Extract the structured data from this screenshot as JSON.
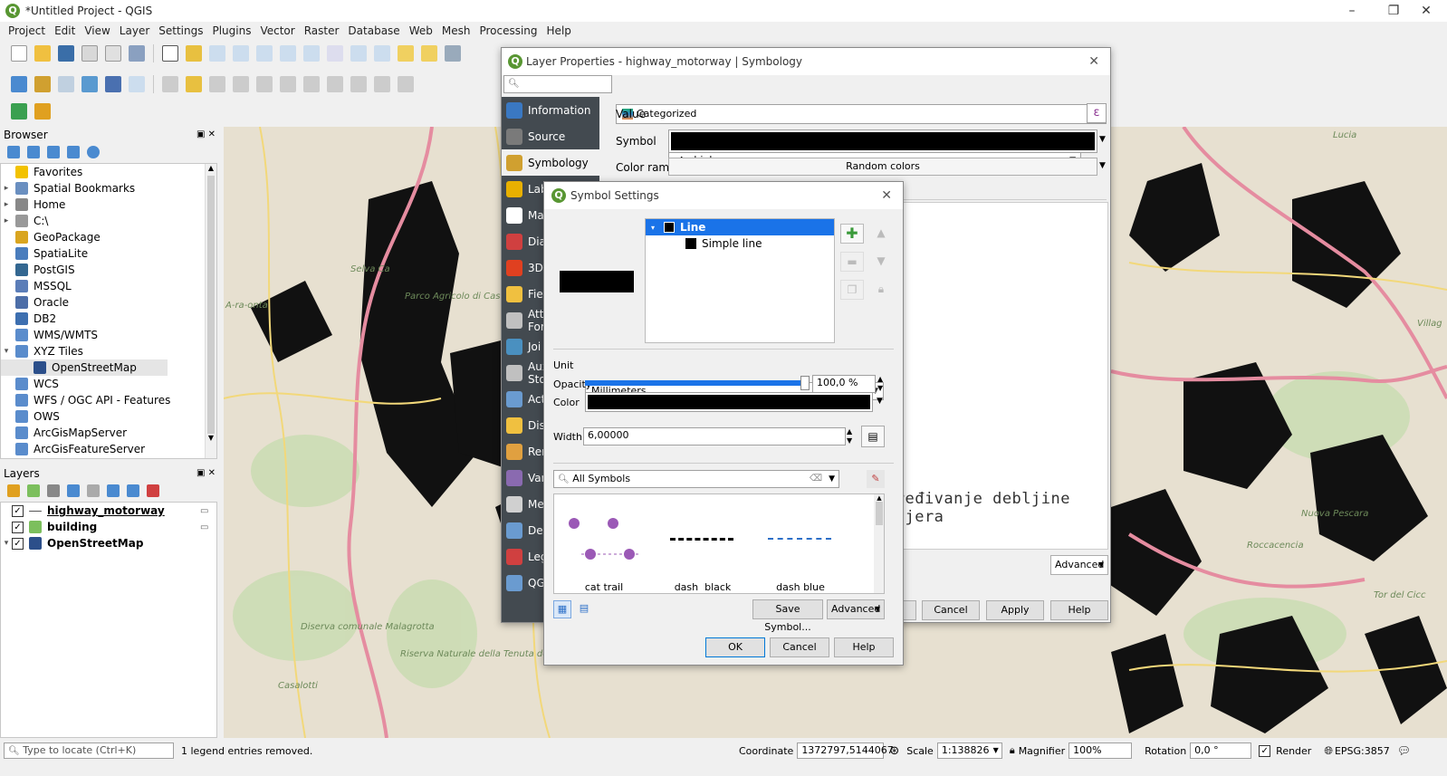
{
  "window": {
    "title": "*Untitled Project - QGIS"
  },
  "menu": [
    "Project",
    "Edit",
    "View",
    "Layer",
    "Settings",
    "Plugins",
    "Vector",
    "Raster",
    "Database",
    "Web",
    "Mesh",
    "Processing",
    "Help"
  ],
  "browser": {
    "title": "Browser",
    "items": [
      {
        "label": "Favorites",
        "icon": "star-icon",
        "color": "#f2c200",
        "arrow": ""
      },
      {
        "label": "Spatial Bookmarks",
        "icon": "bookmark-icon",
        "color": "#6a8fc0",
        "arrow": "▸"
      },
      {
        "label": "Home",
        "icon": "home-icon",
        "color": "#888",
        "arrow": "▸"
      },
      {
        "label": "C:\\",
        "icon": "drive-icon",
        "color": "#999",
        "arrow": "▸"
      },
      {
        "label": "GeoPackage",
        "icon": "geopackage-icon",
        "color": "#d9a520",
        "arrow": ""
      },
      {
        "label": "SpatiaLite",
        "icon": "spatialite-icon",
        "color": "#4a7dbd",
        "arrow": ""
      },
      {
        "label": "PostGIS",
        "icon": "postgis-icon",
        "color": "#336791",
        "arrow": ""
      },
      {
        "label": "MSSQL",
        "icon": "mssql-icon",
        "color": "#5b7db8",
        "arrow": ""
      },
      {
        "label": "Oracle",
        "icon": "oracle-icon",
        "color": "#4d6ea8",
        "arrow": ""
      },
      {
        "label": "DB2",
        "icon": "db2-icon",
        "color": "#3d6fb0",
        "arrow": ""
      },
      {
        "label": "WMS/WMTS",
        "icon": "globe-icon",
        "color": "#5a8ccc",
        "arrow": ""
      },
      {
        "label": "XYZ Tiles",
        "icon": "globe-icon",
        "color": "#5a8ccc",
        "arrow": "▾"
      },
      {
        "label": "OpenStreetMap",
        "icon": "grid-icon",
        "color": "#2c4f8a",
        "arrow": "",
        "indent": true,
        "selected": true
      },
      {
        "label": "WCS",
        "icon": "globe-icon",
        "color": "#5a8ccc",
        "arrow": ""
      },
      {
        "label": "WFS / OGC API - Features",
        "icon": "globe-icon",
        "color": "#5a8ccc",
        "arrow": ""
      },
      {
        "label": "OWS",
        "icon": "globe-icon",
        "color": "#5a8ccc",
        "arrow": ""
      },
      {
        "label": "ArcGisMapServer",
        "icon": "globe-icon",
        "color": "#5a8ccc",
        "arrow": ""
      },
      {
        "label": "ArcGisFeatureServer",
        "icon": "globe-icon",
        "color": "#5a8ccc",
        "arrow": ""
      }
    ]
  },
  "layers": {
    "title": "Layers",
    "items": [
      {
        "label": "highway_motorway",
        "underline": true,
        "icon": "line-icon",
        "color": "#555"
      },
      {
        "label": "building",
        "underline": false,
        "icon": "polygon-icon",
        "color": "#7cbf5d"
      },
      {
        "label": "OpenStreetMap",
        "underline": false,
        "icon": "grid-icon",
        "color": "#2c4f8a",
        "arrow": "▾"
      }
    ]
  },
  "layer_props": {
    "title": "Layer Properties - highway_motorway | Symbology",
    "renderer": "Categorized",
    "value_label": "Value",
    "value": "highway",
    "value_prefix": "abc",
    "symbol_label": "Symbol",
    "color_ramp_label": "Color ramp",
    "color_ramp": "Random colors",
    "tabs": [
      {
        "label": "Information",
        "color": "#3a78c2",
        "icon": "info-icon"
      },
      {
        "label": "Source",
        "color": "#7a7a7a",
        "icon": "source-icon"
      },
      {
        "label": "Symbology",
        "color": "#d0a030",
        "icon": "symbology-icon",
        "selected": true
      },
      {
        "label": "Lab",
        "color": "#e8b000",
        "icon": "labels-icon"
      },
      {
        "label": "Ma",
        "color": "#ffffff",
        "icon": "masks-icon"
      },
      {
        "label": "Dia",
        "color": "#d04040",
        "icon": "diagrams-icon"
      },
      {
        "label": "3D",
        "color": "#e04020",
        "icon": "3d-icon"
      },
      {
        "label": "Fie",
        "color": "#f0c040",
        "icon": "fields-icon"
      },
      {
        "label": "Att",
        "label2": "For",
        "color": "#c0c0c0",
        "icon": "attributes-form-icon"
      },
      {
        "label": "Joi",
        "color": "#4a90c0",
        "icon": "joins-icon"
      },
      {
        "label": "Aux",
        "label2": "Sto",
        "color": "#c0c0c0",
        "icon": "auxiliary-storage-icon"
      },
      {
        "label": "Act",
        "color": "#6a9bd0",
        "icon": "actions-icon"
      },
      {
        "label": "Dis",
        "color": "#f0c040",
        "icon": "display-icon"
      },
      {
        "label": "Ren",
        "color": "#e0a040",
        "icon": "rendering-icon"
      },
      {
        "label": "Var",
        "color": "#8a6ab0",
        "icon": "variables-icon"
      },
      {
        "label": "Me",
        "color": "#d0d0d0",
        "icon": "metadata-icon"
      },
      {
        "label": "Dep",
        "color": "#6a9bd0",
        "icon": "dependencies-icon"
      },
      {
        "label": "Leg",
        "color": "#d04040",
        "icon": "legend-icon"
      },
      {
        "label": "QG",
        "color": "#6a9bd0",
        "icon": "qgis-server-icon"
      }
    ],
    "advanced": "Advanced",
    "cancel": "Cancel",
    "apply": "Apply",
    "help": "Help",
    "annotation": "Sređivanje debljine lejera"
  },
  "symbol_settings": {
    "title": "Symbol Settings",
    "tree": [
      {
        "label": "Line",
        "selected": true
      },
      {
        "label": "Simple line",
        "selected": false
      }
    ],
    "unit_label": "Unit",
    "unit": "Millimeters",
    "opacity_label": "Opacity",
    "opacity": "100,0 %",
    "opacity_value": 1.0,
    "color_label": "Color",
    "width_label": "Width",
    "width": "6,00000",
    "search_placeholder": "All Symbols",
    "symbols": [
      {
        "name": "cat trail",
        "icon": "paw-icon"
      },
      {
        "name": "dash  black",
        "icon": "dash-black-icon"
      },
      {
        "name": "dash blue",
        "icon": "dash-blue-icon"
      }
    ],
    "save_symbol": "Save Symbol...",
    "advanced": "Advanced",
    "ok": "OK",
    "cancel": "Cancel",
    "help": "Help"
  },
  "status": {
    "locate_placeholder": "Type to locate (Ctrl+K)",
    "message": "1 legend entries removed.",
    "coordinate_label": "Coordinate",
    "coordinate": "1372797,5144067",
    "scale_label": "Scale",
    "scale": "1:138826",
    "magnifier_label": "Magnifier",
    "magnifier": "100%",
    "rotation_label": "Rotation",
    "rotation": "0,0 °",
    "render_label": "Render",
    "crs": "EPSG:3857"
  },
  "map_labels": [
    "Selva Ca",
    "Parco Agricolo di Casal del Marmo",
    "Riserva Naturale della Tenuta dei Massimi",
    "Diserva comunale Malagrotta",
    "Casalotti",
    "Lucia",
    "Villag",
    "Roccacencia",
    "Tor del Cicc",
    "Nuova Pescara",
    "A-ra-onta"
  ]
}
